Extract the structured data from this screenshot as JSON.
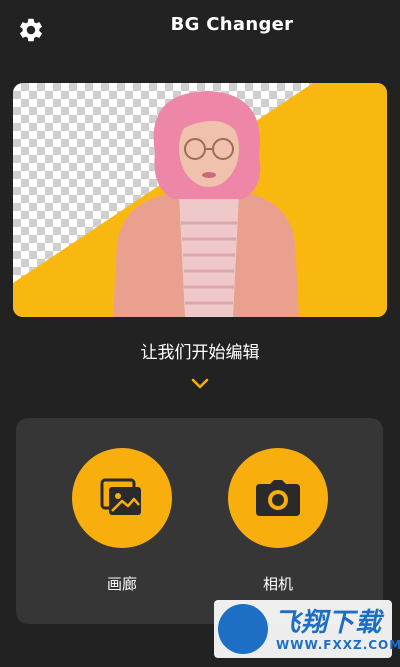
{
  "header": {
    "title": "BG Changer",
    "settings_icon": "gear-icon"
  },
  "hero": {
    "image": "woman-with-pink-hair-background-removal-preview",
    "accent_color": "#F9B80F"
  },
  "prompt": {
    "text": "让我们开始编辑",
    "chevron_icon": "chevron-down-icon"
  },
  "actions": {
    "gallery": {
      "label": "画廊",
      "icon": "gallery-icon"
    },
    "camera": {
      "label": "相机",
      "icon": "camera-icon"
    },
    "button_color": "#F8AE0C"
  },
  "watermark": {
    "brand": "飞翔下载",
    "url": "WWW.FXXZ.COM"
  }
}
